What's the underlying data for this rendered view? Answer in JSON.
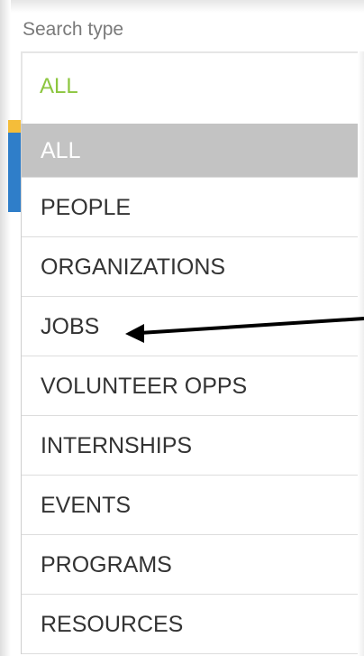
{
  "search_type": {
    "label": "Search type",
    "selected_value": "ALL",
    "options": [
      "ALL",
      "PEOPLE",
      "ORGANIZATIONS",
      "JOBS",
      "VOLUNTEER OPPS",
      "INTERNSHIPS",
      "EVENTS",
      "PROGRAMS",
      "RESOURCES"
    ]
  },
  "colors": {
    "selected_value": "#8cc63f",
    "selected_option_bg": "#c3c3c3",
    "arrow": "#000000"
  },
  "annotation": {
    "arrow_target": "JOBS"
  }
}
